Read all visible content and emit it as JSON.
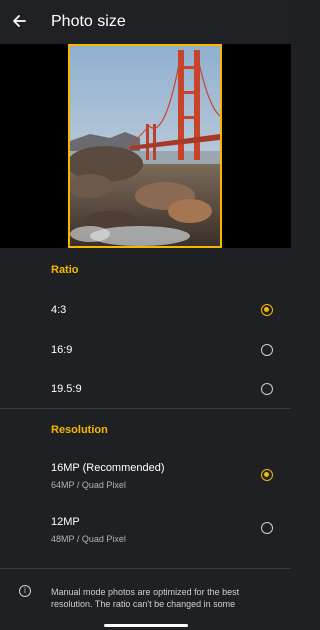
{
  "header": {
    "title": "Photo size",
    "back_icon": "arrow-left-icon"
  },
  "colors": {
    "accent": "#f5b800",
    "background": "#1f2024",
    "preview_background": "#000000"
  },
  "preview": {
    "description_icon": "photo-preview"
  },
  "ratio": {
    "title": "Ratio",
    "options": [
      {
        "label": "4:3",
        "selected": true
      },
      {
        "label": "16:9",
        "selected": false
      },
      {
        "label": "19.5:9",
        "selected": false
      }
    ]
  },
  "resolution": {
    "title": "Resolution",
    "options": [
      {
        "label": "16MP (Recommended)",
        "sublabel": "64MP / Quad Pixel",
        "selected": true
      },
      {
        "label": "12MP",
        "sublabel": "48MP / Quad Pixel",
        "selected": false
      }
    ]
  },
  "info": {
    "icon": "info-icon",
    "text": "Manual mode photos are optimized for the best resolution. The ratio can't be changed in some"
  }
}
